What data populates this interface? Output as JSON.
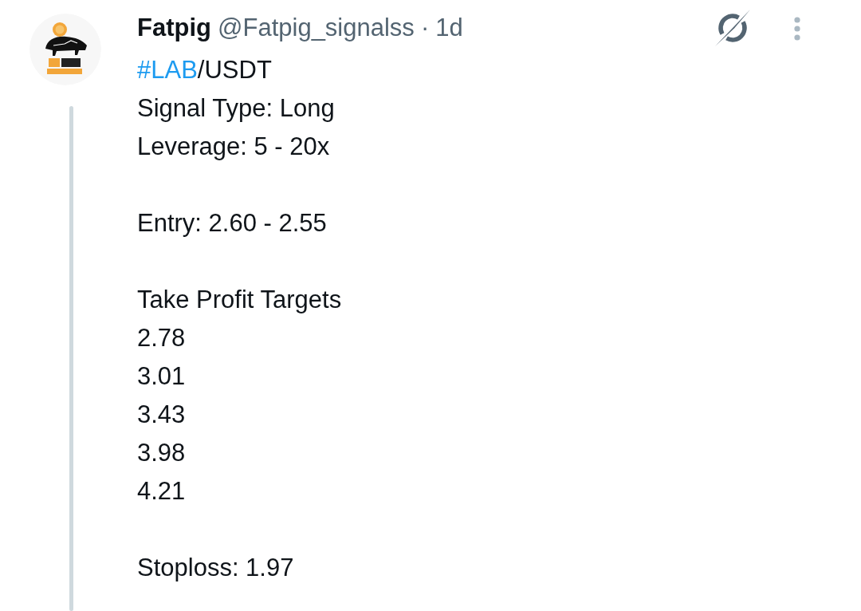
{
  "post": {
    "author": {
      "name": "Fatpig",
      "handle": "@Fatpig_signalss",
      "separator": "·",
      "time": "1d"
    },
    "paragraphs": [
      [
        {
          "hashtag": "#LAB",
          "text": "/USDT"
        },
        {
          "text": "Signal Type: Long"
        },
        {
          "text": "Leverage: 5 - 20x"
        }
      ],
      [
        {
          "text": "Entry: 2.60 - 2.55"
        }
      ],
      [
        {
          "text": "Take Profit Targets"
        },
        {
          "text": "2.78"
        },
        {
          "text": "3.01"
        },
        {
          "text": "3.43"
        },
        {
          "text": "3.98"
        },
        {
          "text": "4.21"
        }
      ],
      [
        {
          "text": "Stoploss: 1.97"
        }
      ]
    ]
  }
}
